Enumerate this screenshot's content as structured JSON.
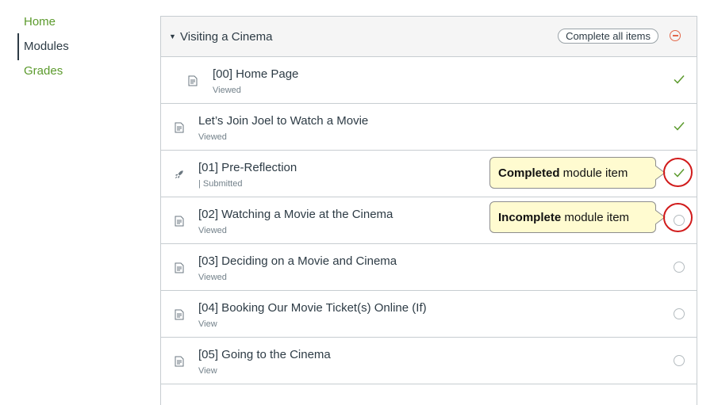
{
  "nav": {
    "items": [
      {
        "label": "Home",
        "active": false
      },
      {
        "label": "Modules",
        "active": true
      },
      {
        "label": "Grades",
        "active": false
      }
    ]
  },
  "module": {
    "title": "Visiting a Cinema",
    "complete_all_label": "Complete all items",
    "items": [
      {
        "title": "[00] Home Page",
        "status": "Viewed",
        "icon": "page-icon",
        "completed": true
      },
      {
        "title": "Let’s Join Joel to Watch a Movie",
        "status": "Viewed",
        "icon": "page-icon",
        "completed": true
      },
      {
        "title": "[01] Pre-Reflection",
        "status": "|  Submitted",
        "icon": "rocket-icon",
        "completed": true
      },
      {
        "title": "[02] Watching a Movie at the Cinema",
        "status": "Viewed",
        "icon": "page-icon",
        "completed": false
      },
      {
        "title": "[03] Deciding on a Movie and Cinema",
        "status": "Viewed",
        "icon": "page-icon",
        "completed": false
      },
      {
        "title": "[04] Booking Our Movie Ticket(s) Online (If)",
        "status": "View",
        "icon": "page-icon",
        "completed": false
      },
      {
        "title": "[05] Going to the Cinema",
        "status": "View",
        "icon": "page-icon",
        "completed": false
      }
    ]
  },
  "callouts": {
    "completed": {
      "bold": "Completed",
      "rest": " module item"
    },
    "incomplete": {
      "bold": "Incomplete",
      "rest": " module item"
    }
  },
  "colors": {
    "accent_green": "#5b9a2c",
    "highlight_red": "#d11b1b",
    "callout_bg": "#fffbd0"
  }
}
